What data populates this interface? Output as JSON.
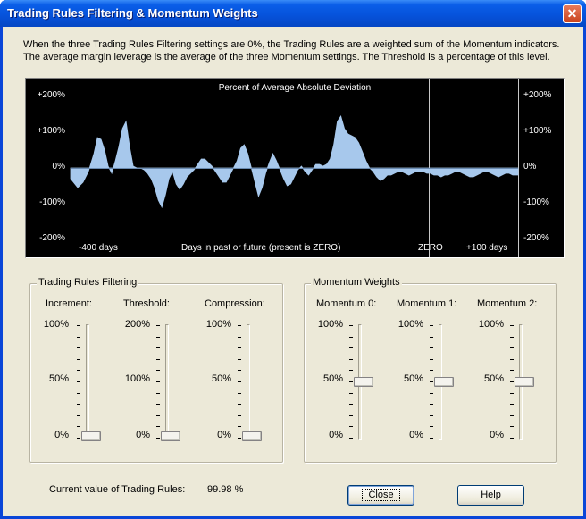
{
  "window": {
    "title": "Trading Rules Filtering & Momentum Weights",
    "close_glyph": "✕"
  },
  "description": {
    "line1": "When the three Trading Rules Filtering settings are 0%, the Trading Rules are a weighted sum of the Momentum indicators.",
    "line2": "The average margin leverage is the average of the three Momentum settings. The Threshold is a percentage of this level."
  },
  "chart_data": {
    "type": "area",
    "title": "Percent of Average Absolute Deviation",
    "xlabel": "Days in past or future (present is ZERO)",
    "x_tick_labels": [
      "-400 days",
      "ZERO",
      "+100 days"
    ],
    "y_tick_labels": [
      "+200%",
      "+100%",
      "0%",
      "-100%",
      "-200%"
    ],
    "xlim": [
      -400,
      100
    ],
    "ylim": [
      -200,
      200
    ],
    "fill_color": "#a7c8ec",
    "background": "#000000",
    "x": [
      -400,
      -392,
      -386,
      -380,
      -374,
      -370,
      -366,
      -362,
      -358,
      -354,
      -350,
      -346,
      -342,
      -338,
      -334,
      -330,
      -326,
      -322,
      -318,
      -314,
      -310,
      -306,
      -302,
      -298,
      -294,
      -290,
      -286,
      -282,
      -278,
      -274,
      -270,
      -266,
      -262,
      -258,
      -254,
      -250,
      -246,
      -242,
      -238,
      -234,
      -230,
      -226,
      -222,
      -218,
      -214,
      -210,
      -206,
      -202,
      -198,
      -194,
      -190,
      -186,
      -182,
      -178,
      -174,
      -170,
      -166,
      -162,
      -158,
      -154,
      -150,
      -146,
      -142,
      -138,
      -134,
      -130,
      -126,
      -122,
      -118,
      -114,
      -110,
      -106,
      -102,
      -98,
      -94,
      -90,
      -86,
      -82,
      -78,
      -74,
      -70,
      -66,
      -62,
      -58,
      -54,
      -50,
      -46,
      -42,
      -38,
      -34,
      -30,
      -26,
      -22,
      -18,
      -14,
      -10,
      -6,
      -2,
      2,
      6,
      10,
      14,
      18,
      22,
      26,
      30,
      34,
      38,
      42,
      46,
      50,
      54,
      58,
      62,
      66,
      70,
      74,
      78,
      82,
      86,
      90,
      94,
      100
    ],
    "y": [
      -30,
      -55,
      -40,
      -10,
      40,
      85,
      80,
      50,
      5,
      -15,
      20,
      60,
      110,
      130,
      60,
      5,
      0,
      0,
      -5,
      -15,
      -30,
      -55,
      -90,
      -110,
      -75,
      -30,
      -10,
      -45,
      -60,
      -45,
      -25,
      -15,
      -5,
      10,
      25,
      25,
      15,
      5,
      -10,
      -25,
      -40,
      -40,
      -20,
      0,
      20,
      55,
      65,
      40,
      0,
      -40,
      -80,
      -55,
      -15,
      15,
      40,
      20,
      -5,
      -30,
      -50,
      -45,
      -25,
      -5,
      5,
      -10,
      -20,
      -5,
      10,
      10,
      5,
      10,
      25,
      65,
      130,
      145,
      110,
      95,
      90,
      85,
      70,
      45,
      20,
      0,
      -10,
      -25,
      -35,
      -30,
      -20,
      -20,
      -15,
      -10,
      -10,
      -15,
      -20,
      -15,
      -10,
      -10,
      -10,
      -15,
      -15,
      -20,
      -20,
      -25,
      -20,
      -20,
      -15,
      -10,
      -10,
      -15,
      -20,
      -25,
      -25,
      -20,
      -15,
      -10,
      -10,
      -15,
      -20,
      -25,
      -20,
      -15,
      -15,
      -20,
      -20
    ]
  },
  "trading_rules_filtering": {
    "title": "Trading Rules Filtering",
    "sliders": [
      {
        "label": "Increment:",
        "ticks": [
          "100%",
          "50%",
          "0%"
        ],
        "value_fraction": 0.0
      },
      {
        "label": "Threshold:",
        "ticks": [
          "200%",
          "100%",
          "0%"
        ],
        "value_fraction": 0.0
      },
      {
        "label": "Compression:",
        "ticks": [
          "100%",
          "50%",
          "0%"
        ],
        "value_fraction": 0.0
      }
    ]
  },
  "momentum_weights": {
    "title": "Momentum Weights",
    "sliders": [
      {
        "label": "Momentum 0:",
        "ticks": [
          "100%",
          "50%",
          "0%"
        ],
        "value_fraction": 0.5
      },
      {
        "label": "Momentum 1:",
        "ticks": [
          "100%",
          "50%",
          "0%"
        ],
        "value_fraction": 0.5
      },
      {
        "label": "Momentum 2:",
        "ticks": [
          "100%",
          "50%",
          "0%"
        ],
        "value_fraction": 0.5
      }
    ]
  },
  "status": {
    "label": "Current value of Trading Rules:",
    "value": "99.98 %"
  },
  "buttons": {
    "close_label": "Close",
    "help_label": "Help"
  }
}
